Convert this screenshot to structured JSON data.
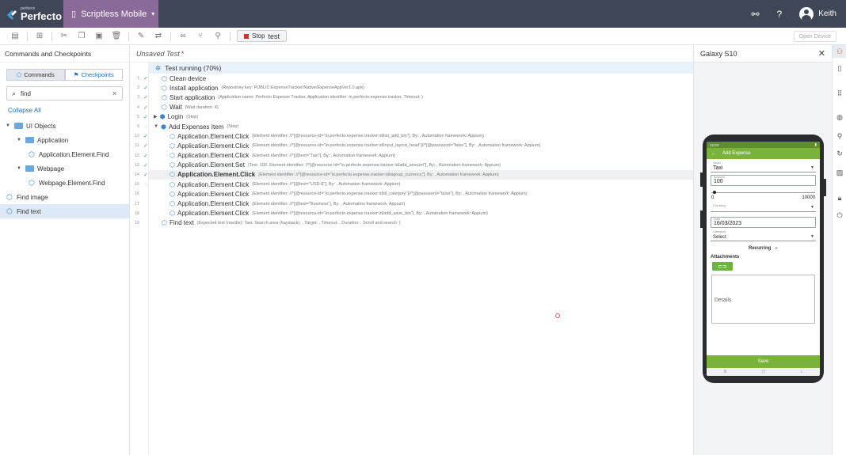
{
  "topbar": {
    "logo_small": "perforce",
    "logo_big": "Perfecto",
    "product": "Scriptless Mobile",
    "user": "Keith"
  },
  "toolbar": {
    "stop_label": "Stop",
    "stop_label2": "test",
    "open_device": "Open Device"
  },
  "left": {
    "title": "Commands and Checkpoints",
    "tab_commands": "Commands",
    "tab_checkpoints": "Checkpoints",
    "search_value": "find",
    "collapse_all": "Collapse All",
    "tree": [
      {
        "label": "UI Objects"
      },
      {
        "label": "Application"
      },
      {
        "label": "Application.Element.Find"
      },
      {
        "label": "Webpage"
      },
      {
        "label": "Webpage.Element.Find"
      },
      {
        "label": "Find image"
      },
      {
        "label": "Find text"
      }
    ]
  },
  "editor": {
    "title": "Unsaved Test",
    "title_mark": "*",
    "running": "Test running (70%)",
    "steps": [
      {
        "num": "1",
        "name": "Clean device",
        "detail": ""
      },
      {
        "num": "2",
        "name": "Install application",
        "detail": "(Repository key: PUBLIC:ExpenseTracker/Native/ExpenseAppVer1.0.apk)"
      },
      {
        "num": "3",
        "name": "Start application",
        "detail": "(Application name: Perfecto Expense Tracker, Application identifier: io.perfecto.expense.tracker, Timeout: )"
      },
      {
        "num": "4",
        "name": "Wait",
        "detail": "(Wait duration: 4)"
      },
      {
        "num": "5",
        "name": "Login",
        "detail": "(Step)"
      },
      {
        "num": "9",
        "name": "Add Expenses Item",
        "detail": "(Step)"
      },
      {
        "num": "10",
        "name": "Application.Element.Click",
        "detail": "(Element identifier: //*[@resource-id=\"io.perfecto.expense.tracker:id/list_add_btn\"], By: , Automation framework: Appium)"
      },
      {
        "num": "11",
        "name": "Application.Element.Click",
        "detail": "(Element identifier: //*[@resource-id=\"io.perfecto.expense.tracker:id/input_layout_head\"]//*[@password=\"false\"], By: , Automation framework: Appium)"
      },
      {
        "num": "12",
        "name": "Application.Element.Click",
        "detail": "(Element identifier: //*[@text=\"Taxi\"], By: , Automation framework: Appium)"
      },
      {
        "num": "13",
        "name": "Application.Element.Set",
        "detail": "(Text: 100, Element identifier: //*[@resource-id=\"io.perfecto.expense.tracker:id/add_amount\"], By: , Automation framework: Appium)"
      },
      {
        "num": "14",
        "name": "Application.Element.Click",
        "detail": "(Element identifier: //*[@resource-id=\"io.perfecto.expense.tracker:id/signup_currency\"], By: , Automation framework: Appium)"
      },
      {
        "num": "15",
        "name": "Application.Element.Click",
        "detail": "(Element identifier: //*[@text=\"USD-$\"], By: , Automation framework: Appium)"
      },
      {
        "num": "16",
        "name": "Application.Element.Click",
        "detail": "(Element identifier: //*[@resource-id=\"io.perfecto.expense.tracker:id/til_category\"]//*[@password=\"false\"], By: , Automation framework: Appium)"
      },
      {
        "num": "17",
        "name": "Application.Element.Click",
        "detail": "(Element identifier: //*[@text=\"Business\"], By: , Automation framework: Appium)"
      },
      {
        "num": "18",
        "name": "Application.Element.Click",
        "detail": "(Element identifier: //*[@resource-id=\"io.perfecto.expense.tracker:id/add_save_btn\"], By: , Automation framework: Appium)"
      },
      {
        "num": "19",
        "name": "Find text",
        "detail": "(Expected text (needle): Taxi, Search area (haystack): , Target: , Timeout: , Duration: , Scroll and search: )"
      }
    ]
  },
  "device": {
    "title": "Galaxy S10",
    "status_time": "12:23",
    "appbar_title": "Add Expense",
    "head_label": "Head",
    "head_value": "Taxi",
    "amount_label": "Amount",
    "amount_value": "100",
    "slider_min": "0",
    "slider_max": "10000",
    "currency_label": "Currency",
    "date_label": "Date",
    "date_value": "16/03/2023",
    "category_label": "Category",
    "category_value": "Select",
    "recurring": "Recurring",
    "attachments": "Attachments",
    "details": "Details",
    "save": "Save"
  },
  "colors": {
    "topbar": "#3f4756",
    "product": "#8b6a9a",
    "accent": "#1a73c2",
    "app_green": "#7ab33c",
    "check": "#3aa14a"
  }
}
